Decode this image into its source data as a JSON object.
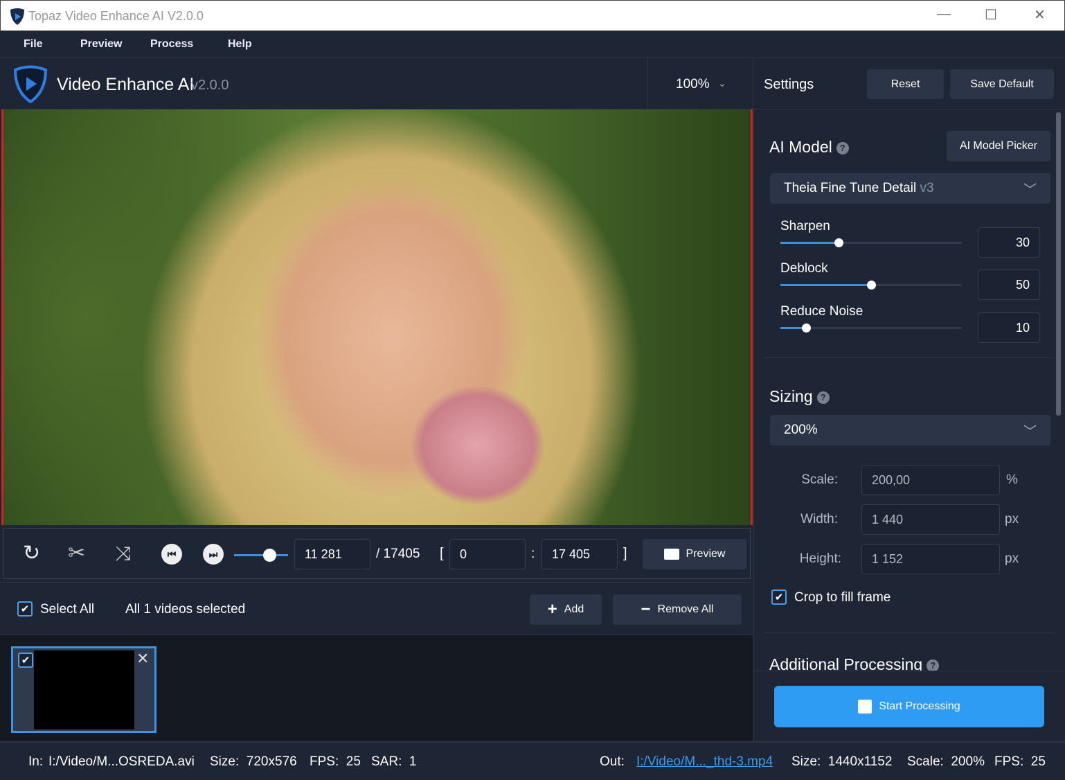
{
  "window": {
    "title": "Topaz Video Enhance AI V2.0.0",
    "minimize": "—",
    "maximize": "☐",
    "close": "✕"
  },
  "menu": [
    "File",
    "Preview",
    "Process",
    "Help"
  ],
  "header": {
    "app_name": "Video Enhance AI",
    "version": "v2.0.0",
    "zoom": "100%",
    "settings_label": "Settings",
    "reset": "Reset",
    "save_default": "Save Default"
  },
  "controls": {
    "current_frame": "11 281",
    "total_frames": "/ 17405",
    "open_bracket": "[",
    "range_start": "0",
    "colon": ":",
    "range_end": "17 405",
    "close_bracket": "]",
    "preview": "Preview",
    "playhead_fraction": 0.65
  },
  "selection": {
    "select_all": "Select All",
    "status": "All 1 videos selected",
    "add": "Add",
    "remove_all": "Remove All"
  },
  "ai_model": {
    "title": "AI Model",
    "picker": "AI Model Picker",
    "model": "Theia Fine Tune Detail",
    "model_version": "v3",
    "sliders": [
      {
        "label": "Sharpen",
        "value": "30",
        "fraction": 0.32
      },
      {
        "label": "Deblock",
        "value": "50",
        "fraction": 0.5
      },
      {
        "label": "Reduce Noise",
        "value": "10",
        "fraction": 0.14
      }
    ]
  },
  "sizing": {
    "title": "Sizing",
    "preset": "200%",
    "scale_label": "Scale:",
    "scale": "200,00",
    "scale_unit": "%",
    "width_label": "Width:",
    "width": "1 440",
    "width_unit": "px",
    "height_label": "Height:",
    "height": "1 152",
    "height_unit": "px",
    "crop": "Crop to fill frame"
  },
  "additional": {
    "title": "Additional Processing"
  },
  "start": "Start Processing",
  "status": {
    "in": "In:",
    "in_file": "I:/Video/M...OSREDA.avi",
    "in_size": "Size:  720x576",
    "in_fps": "FPS:  25",
    "in_sar": "SAR:  1",
    "out": "Out:",
    "out_file": "I:/Video/M..._thd-3.mp4",
    "out_size": "Size:  1440x1152",
    "out_scale": "Scale:  200%",
    "out_fps": "FPS:  25"
  },
  "colors": {
    "accent": "#2e9cf2",
    "bg": "#1e2535",
    "border_red": "#d82020"
  }
}
